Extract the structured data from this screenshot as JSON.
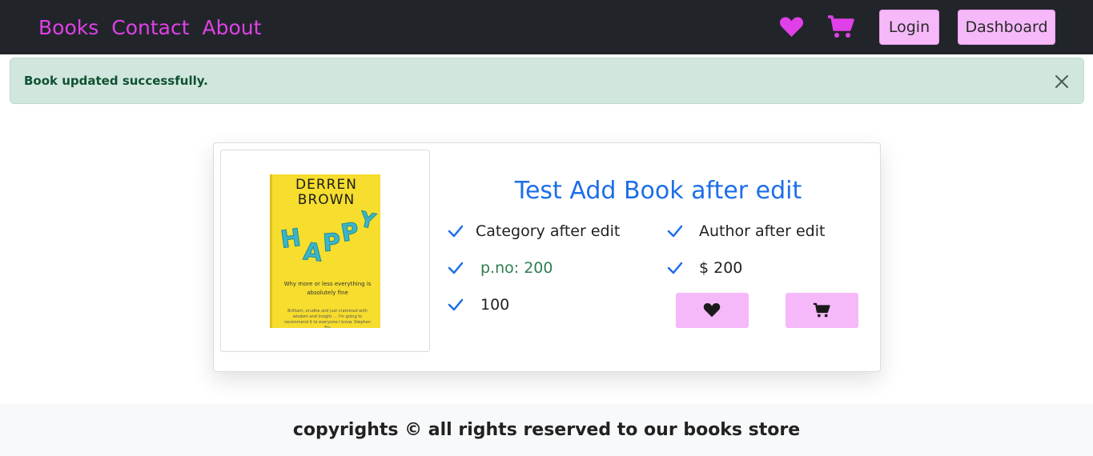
{
  "nav": {
    "links": [
      "Books",
      "Contact",
      "About"
    ],
    "login_label": "Login",
    "dashboard_label": "Dashboard",
    "icons": [
      "heart-icon",
      "cart-icon"
    ],
    "accent_color": "#e040e8",
    "button_color": "#f5b8f9"
  },
  "alert": {
    "message": "Book updated successfully."
  },
  "book": {
    "title": "Test Add Book after edit",
    "category": "Category after edit",
    "author": "Author after edit",
    "pages": "p.no: 200",
    "price": "$ 200",
    "quantity": "100",
    "cover": {
      "author_line1": "DERREN",
      "author_line2": "BROWN",
      "title": "HAPPY",
      "tagline": "Why more or less everything is absolutely fine",
      "blurb": "Brilliant, erudite and just crammed with wisdom and insight ... I'm going to recommend it to everyone I know. Stephen Fry"
    }
  },
  "footer": {
    "text": "copyrights © all rights reserved to our books store"
  }
}
